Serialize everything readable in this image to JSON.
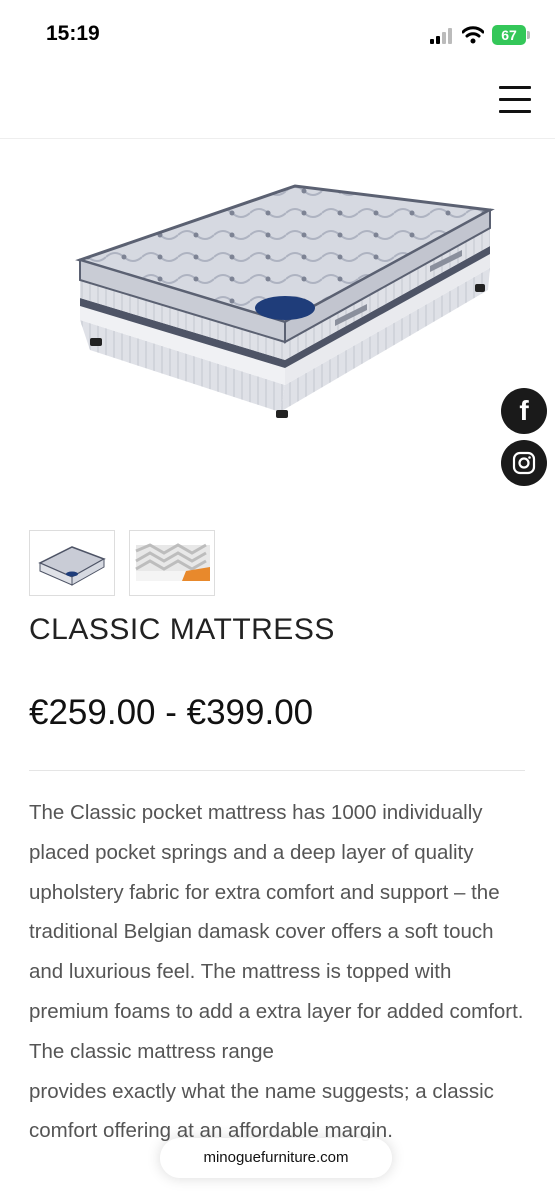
{
  "status_bar": {
    "time": "15:19",
    "battery": "67",
    "battery_color": "#34c759"
  },
  "header": {
    "menu_icon": "hamburger-menu-icon"
  },
  "product": {
    "image_icon": "mattress-photo",
    "thumbnails": [
      "mattress-thumbnail",
      "foam-layer-thumbnail"
    ],
    "title": "CLASSIC MATTRESS",
    "price": "€259.00 - €399.00",
    "description_1": "The Classic pocket mattress has 1000 individually placed pocket springs and a deep layer of quality upholstery fabric for extra comfort and support – the traditional Belgian damask cover offers a soft touch and luxurious feel. The mattress is topped with premium foams to add a extra layer for added comfort. The classic mattress range",
    "description_2": "provides exactly what the name suggests; a classic comfort offering at an affordable margin."
  },
  "social": {
    "facebook_icon": "facebook-icon",
    "instagram_icon": "instagram-icon",
    "facebook_label": "f"
  },
  "browser": {
    "url": "minoguefurniture.com"
  }
}
